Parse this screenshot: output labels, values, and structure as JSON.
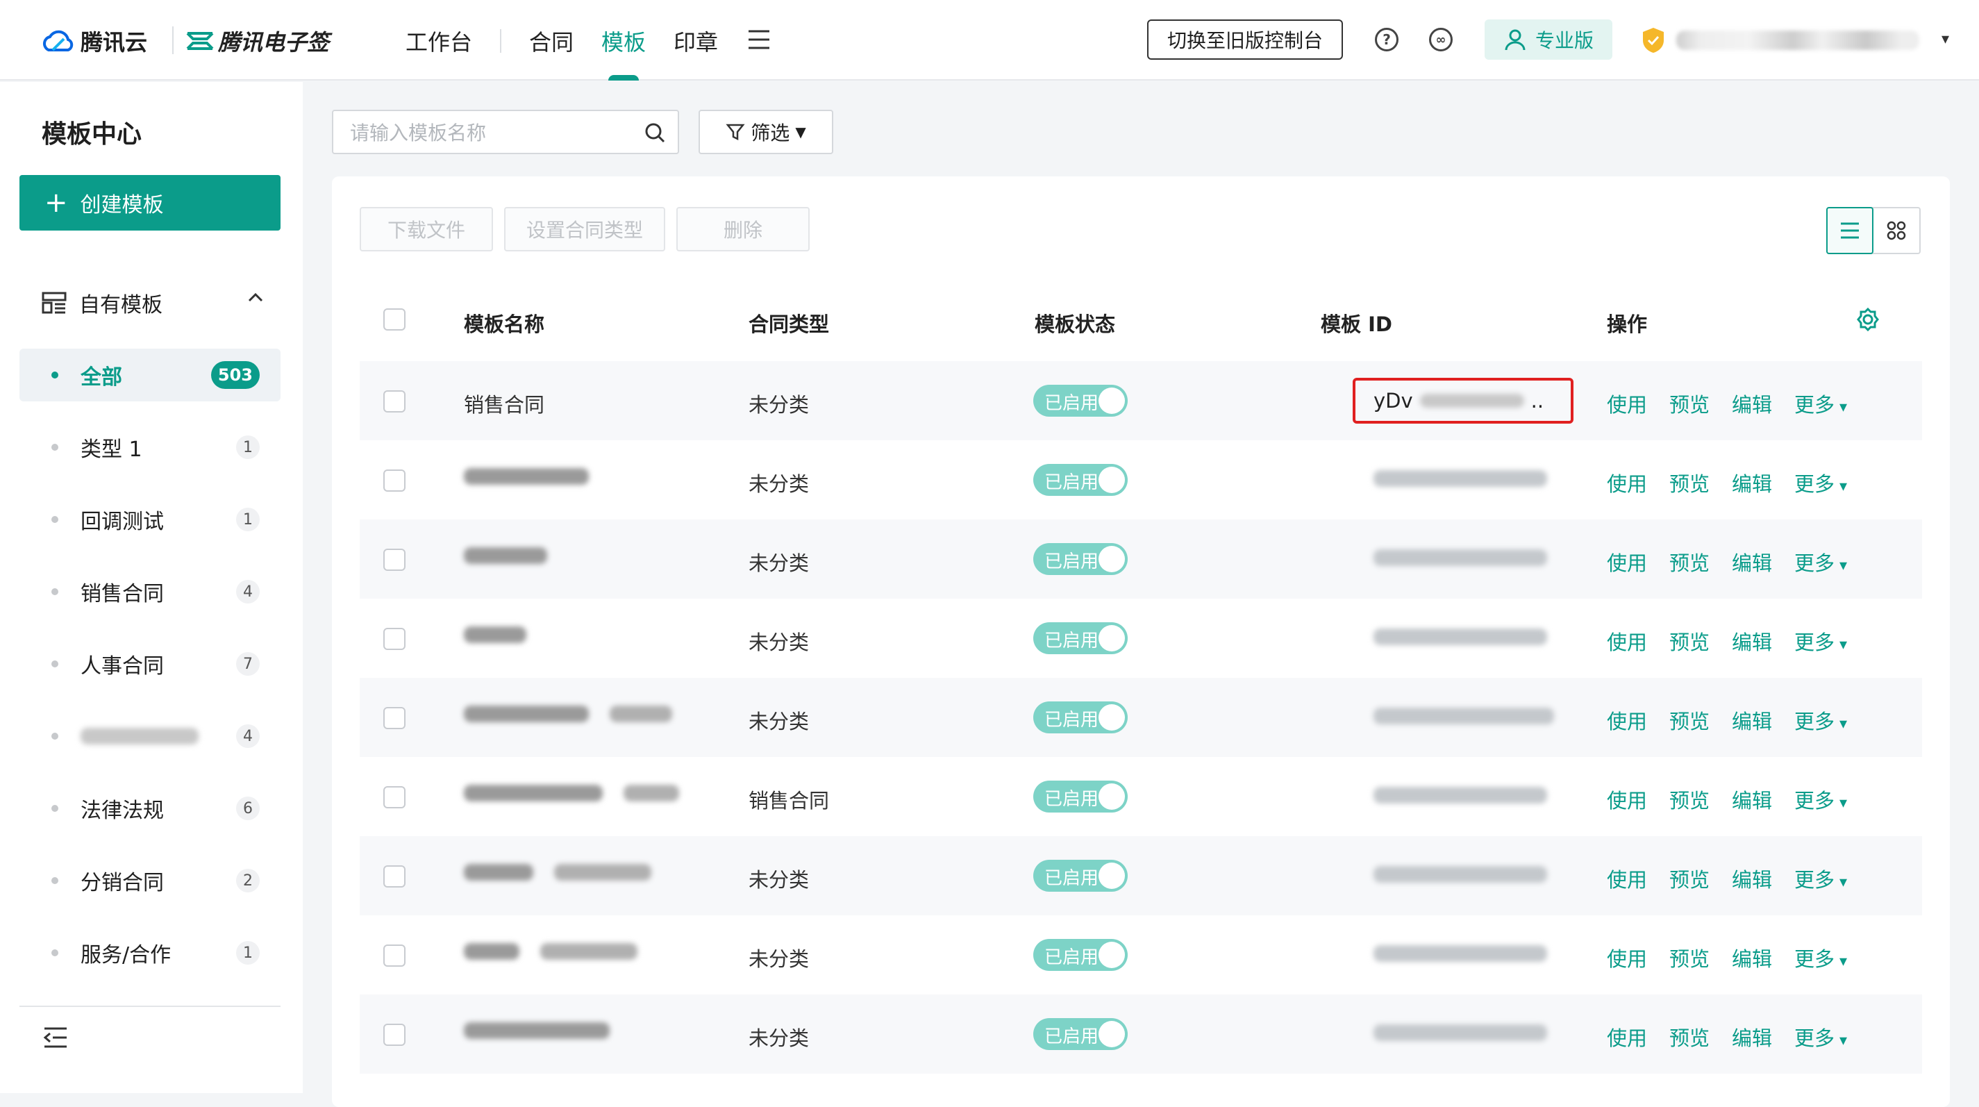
{
  "topbar": {
    "brand_cloud": "腾讯云",
    "brand_esign": "腾讯电子签",
    "nav": [
      "工作台",
      "合同",
      "模板",
      "印章"
    ],
    "active_nav": "模板",
    "legacy_button": "切换至旧版控制台",
    "pro_badge": "专业版"
  },
  "sidebar": {
    "title": "模板中心",
    "create_button": "创建模板",
    "group_label": "自有模板",
    "items": [
      {
        "label": "全部",
        "count": "503",
        "active": true
      },
      {
        "label": "类型 1",
        "count": "1"
      },
      {
        "label": "回调测试",
        "count": "1"
      },
      {
        "label": "销售合同",
        "count": "4"
      },
      {
        "label": "人事合同",
        "count": "7"
      },
      {
        "label": "",
        "count": "4",
        "blurred": true
      },
      {
        "label": "法律法规",
        "count": "6"
      },
      {
        "label": "分销合同",
        "count": "2"
      },
      {
        "label": "服务/合作",
        "count": "1"
      }
    ]
  },
  "main": {
    "search_placeholder": "请输入模板名称",
    "filter_label": "筛选",
    "toolbar": {
      "download": "下载文件",
      "set_type": "设置合同类型",
      "delete": "删除"
    },
    "columns": {
      "name": "模板名称",
      "type": "合同类型",
      "status": "模板状态",
      "id": "模板 ID",
      "ops": "操作"
    },
    "status_label": "已启用",
    "ops": {
      "use": "使用",
      "preview": "预览",
      "edit": "编辑",
      "more": "更多"
    },
    "rows": [
      {
        "name": "销售合同",
        "type": "未分类",
        "id_visible": "yDv",
        "id_suffix": ".."
      },
      {
        "name": "",
        "type": "未分类"
      },
      {
        "name": "",
        "type": "未分类"
      },
      {
        "name": "",
        "type": "未分类"
      },
      {
        "name": "",
        "type": "未分类"
      },
      {
        "name": "",
        "type": "销售合同"
      },
      {
        "name": "",
        "type": "未分类"
      },
      {
        "name": "",
        "type": "未分类"
      },
      {
        "name": "",
        "type": "未分类"
      }
    ]
  },
  "colors": {
    "accent": "#0b9c8a",
    "highlight": "#e02020"
  }
}
